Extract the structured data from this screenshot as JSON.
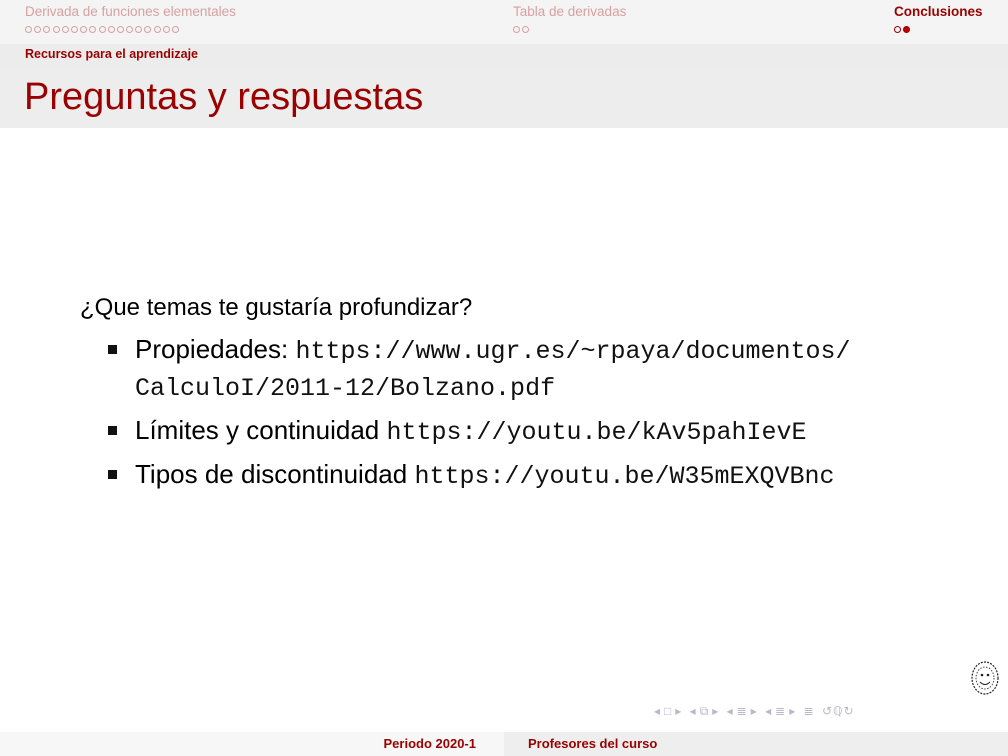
{
  "nav": {
    "sections": [
      {
        "title": "Derivada de funciones elementales",
        "dots": 17,
        "filled": [],
        "active": false
      },
      {
        "title": "Tabla de derivadas",
        "dots": 2,
        "filled": [],
        "active": false
      },
      {
        "title": "Conclusiones",
        "dots": 2,
        "filled": [
          1
        ],
        "active": true
      }
    ],
    "subsection": "Recursos para el aprendizaje"
  },
  "frame": {
    "title": "Preguntas y respuestas",
    "question": "¿Que temas te gustaría profundizar?",
    "items": [
      {
        "label": "Propiedades:",
        "url_line1": "https://www.ugr.es/~rpaya/documentos/",
        "url_line2": "CalculoI/2011-12/Bolzano.pdf"
      },
      {
        "label": "Límites y continuidad",
        "url": "https://youtu.be/kAv5pahIevE"
      },
      {
        "label": "Tipos de discontinuidad",
        "url": "https://youtu.be/W35mEXQVBnc"
      }
    ]
  },
  "navigation_symbols": {
    "prev_frame": "◂",
    "frame": "□",
    "next_frame": "▸",
    "prev_subsec": "◂",
    "subsec": "⧉",
    "next_subsec": "▸",
    "prev_sec": "◂",
    "sec": "≣",
    "next_sec": "▸",
    "prev_doc": "◂",
    "doc": "≣",
    "next_doc": "▸",
    "appendix": "≣",
    "search": "↺ℚ↻"
  },
  "footer": {
    "left": "Periodo 2020-1",
    "right": "Profesores del curso"
  },
  "colors": {
    "accent": "#9b0000",
    "muted": "#d8a0a0",
    "bullet_filled": "#c00000"
  }
}
